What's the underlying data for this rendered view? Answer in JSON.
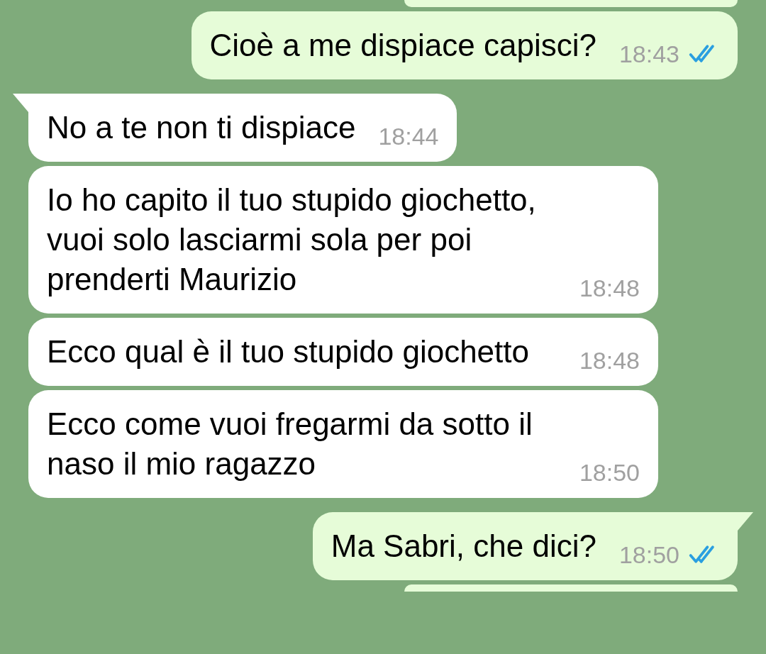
{
  "messages": [
    {
      "kind": "partial_outgoing"
    },
    {
      "kind": "outgoing",
      "text": "Cioè a me dispiace capisci?",
      "time": "18:43",
      "read": true,
      "tail": false
    },
    {
      "kind": "incoming",
      "text": "No a te non ti dispiace",
      "time": "18:44",
      "tail": true
    },
    {
      "kind": "incoming",
      "text": "Io ho capito il tuo stupido giochetto, vuoi solo lasciarmi sola per poi prenderti Maurizio",
      "time": "18:48",
      "tail": false
    },
    {
      "kind": "incoming",
      "text": "Ecco qual è il tuo stupido giochetto",
      "time": "18:48",
      "tail": false
    },
    {
      "kind": "incoming",
      "text": "Ecco come vuoi fregarmi da sotto il naso il mio ragazzo",
      "time": "18:50",
      "tail": false
    },
    {
      "kind": "outgoing",
      "text": "Ma Sabri, che dici?",
      "time": "18:50",
      "read": true,
      "tail": true
    },
    {
      "kind": "partial_outgoing"
    }
  ]
}
